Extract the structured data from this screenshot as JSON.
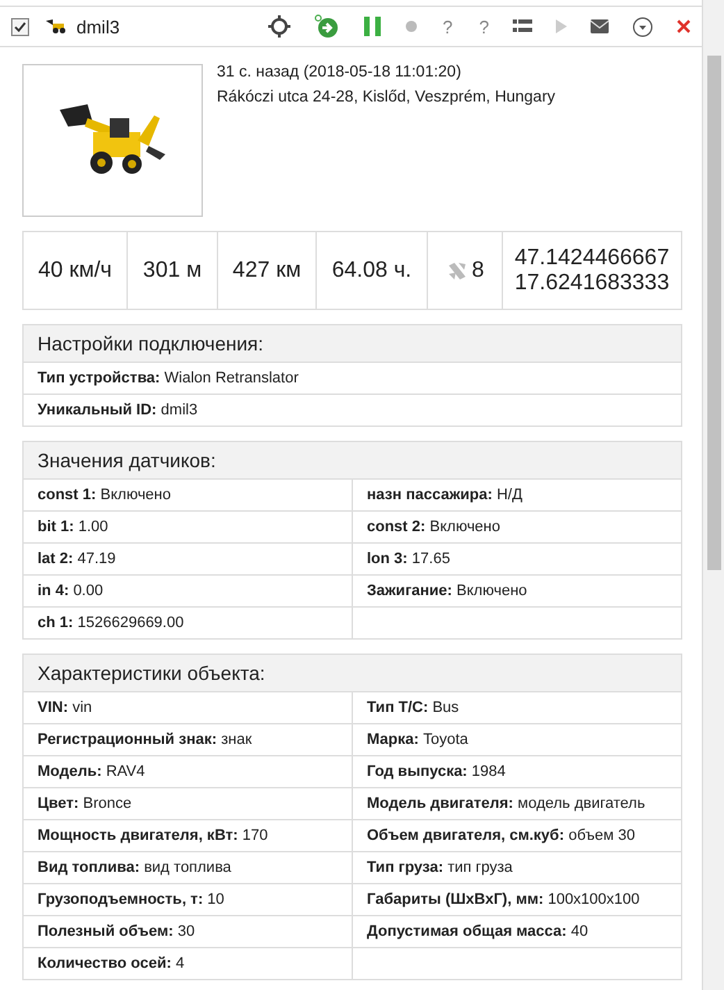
{
  "header": {
    "checked": true,
    "name": "dmil3",
    "toolbar": [
      {
        "kind": "locate"
      },
      {
        "kind": "route"
      },
      {
        "kind": "pause"
      },
      {
        "kind": "dot"
      },
      {
        "kind": "text",
        "text": "?"
      },
      {
        "kind": "text",
        "text": "?"
      },
      {
        "kind": "list"
      },
      {
        "kind": "play"
      },
      {
        "kind": "mail"
      },
      {
        "kind": "menu"
      },
      {
        "kind": "close"
      }
    ]
  },
  "info": {
    "time": "31 с. назад (2018-05-18 11:01:20)",
    "address": "Rákóczi utca 24-28, Kislőd, Veszprém, Hungary"
  },
  "stats": [
    {
      "kind": "text",
      "text": "40 км/ч"
    },
    {
      "kind": "text",
      "text": "301 м"
    },
    {
      "kind": "text",
      "text": "427 км"
    },
    {
      "kind": "text",
      "text": "64.08 ч."
    },
    {
      "kind": "satellites",
      "text": "8"
    },
    {
      "kind": "coords",
      "lines": [
        "47.1424466667",
        "17.6241683333"
      ]
    }
  ],
  "sections": [
    {
      "title": "Настройки подключения:",
      "kind": "single",
      "rows": [
        [
          {
            "label": "Тип устройства:",
            "value": "Wialon Retranslator"
          }
        ],
        [
          {
            "label": "Уникальный ID:",
            "value": "dmil3"
          }
        ]
      ]
    },
    {
      "title": "Значения датчиков:",
      "kind": "pairs",
      "rows": [
        [
          {
            "label": "const 1:",
            "value": "Включено"
          },
          {
            "label": "назн пассажира:",
            "value": "Н/Д"
          }
        ],
        [
          {
            "label": "bit 1:",
            "value": "1.00"
          },
          {
            "label": "const 2:",
            "value": "Включено"
          }
        ],
        [
          {
            "label": "lat 2:",
            "value": "47.19"
          },
          {
            "label": "lon 3:",
            "value": "17.65"
          }
        ],
        [
          {
            "label": "in 4:",
            "value": "0.00"
          },
          {
            "label": "Зажигание:",
            "value": "Включено"
          }
        ],
        [
          {
            "label": "ch 1:",
            "value": "1526629669.00"
          }
        ]
      ]
    },
    {
      "title": "Характеристики объекта:",
      "kind": "pairs",
      "rows": [
        [
          {
            "label": "VIN:",
            "value": "vin"
          },
          {
            "label": "Тип Т/С:",
            "value": "Bus"
          }
        ],
        [
          {
            "label": "Регистрационный знак:",
            "value": "знак"
          },
          {
            "label": "Марка:",
            "value": "Toyota"
          }
        ],
        [
          {
            "label": "Модель:",
            "value": "RAV4"
          },
          {
            "label": "Год выпуска:",
            "value": "1984"
          }
        ],
        [
          {
            "label": "Цвет:",
            "value": "Bronce"
          },
          {
            "label": "Модель двигателя:",
            "value": "модель двигатель"
          }
        ],
        [
          {
            "label": "Мощность двигателя, кВт:",
            "value": "170"
          },
          {
            "label": "Объем двигателя, см.куб:",
            "value": "объем 30"
          }
        ],
        [
          {
            "label": "Вид топлива:",
            "value": "вид топлива"
          },
          {
            "label": "Тип груза:",
            "value": "тип груза"
          }
        ],
        [
          {
            "label": "Грузоподъемность, т:",
            "value": "10"
          },
          {
            "label": "Габариты (ШхВхГ), мм:",
            "value": "100x100x100"
          }
        ],
        [
          {
            "label": "Полезный объем:",
            "value": "30"
          },
          {
            "label": "Допустимая общая масса:",
            "value": "40"
          }
        ],
        [
          {
            "label": "Количество осей:",
            "value": "4"
          }
        ]
      ]
    }
  ]
}
